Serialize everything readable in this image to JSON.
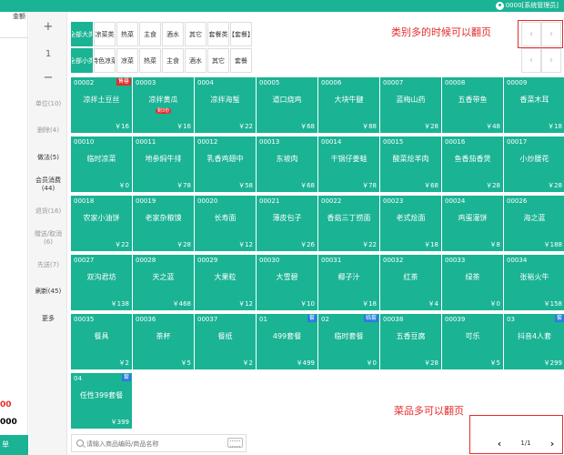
{
  "header": {
    "user_label": "0000[系统管理员]"
  },
  "left_panel": {
    "amount_header": "金额",
    "red_value": "00",
    "black_value": "000",
    "bottom_button": "单"
  },
  "actions": {
    "plus": "+",
    "qty": "1",
    "minus": "−",
    "unit": "单位(10)",
    "delete": "删除(4)",
    "method": "做法(5)",
    "member": "会员消费",
    "member_count": "(44)",
    "return": "退货(16)",
    "gift": "赠送/取消",
    "gift_count": "(6)",
    "deliver": "先送(7)",
    "refresh": "刷新(45)",
    "more": "更多"
  },
  "categories_row1": [
    "全部大类",
    "凉菜类",
    "热菜",
    "主食",
    "酒水",
    "其它",
    "套餐类",
    "【套餐】"
  ],
  "categories_row2": [
    "全部小类",
    "特色凉菜",
    "凉菜",
    "热菜",
    "主食",
    "酒水",
    "其它",
    "套餐"
  ],
  "pager_top": {
    "prev": "‹",
    "next": "›",
    "prev2": "‹",
    "next2": "›"
  },
  "annotations": {
    "top": "类别多的时候可以翻页",
    "bottom": "菜品多可以翻页"
  },
  "tiles": [
    {
      "code": "00002",
      "name": "凉拌土豆丝",
      "price": "￥16",
      "tag": "售罄",
      "tag_color": "red"
    },
    {
      "code": "00003",
      "name": "凉拌黄瓜",
      "price": "￥16",
      "sub": "剩3份"
    },
    {
      "code": "0004",
      "name": "凉拌海蜇",
      "price": "￥22"
    },
    {
      "code": "00005",
      "name": "道口烧鸡",
      "price": "￥68"
    },
    {
      "code": "00006",
      "name": "大块牛腱",
      "price": "￥88"
    },
    {
      "code": "00007",
      "name": "蓝梅山药",
      "price": "￥28"
    },
    {
      "code": "00008",
      "name": "五香带鱼",
      "price": "￥48"
    },
    {
      "code": "00009",
      "name": "香菜木耳",
      "price": "￥18"
    },
    {
      "code": "00010",
      "name": "临时凉菜",
      "price": "￥0"
    },
    {
      "code": "00011",
      "name": "地参焖牛排",
      "price": "￥78"
    },
    {
      "code": "00012",
      "name": "乳香鸡翅中",
      "price": "￥58"
    },
    {
      "code": "00013",
      "name": "东坡肉",
      "price": "￥68"
    },
    {
      "code": "00014",
      "name": "干锅仔姜蛙",
      "price": "￥78"
    },
    {
      "code": "00015",
      "name": "酸菜烩羊肉",
      "price": "￥68"
    },
    {
      "code": "00016",
      "name": "鱼香茄香煲",
      "price": "￥28"
    },
    {
      "code": "00017",
      "name": "小炒腰花",
      "price": "￥28"
    },
    {
      "code": "00018",
      "name": "农家小油饼",
      "price": "￥22"
    },
    {
      "code": "00019",
      "name": "老家杂粮馍",
      "price": "￥28"
    },
    {
      "code": "00020",
      "name": "长寿面",
      "price": "￥12"
    },
    {
      "code": "00021",
      "name": "薄皮包子",
      "price": "￥26"
    },
    {
      "code": "00022",
      "name": "香菇三丁捞面",
      "price": "￥22"
    },
    {
      "code": "00023",
      "name": "老式烩面",
      "price": "￥18"
    },
    {
      "code": "00024",
      "name": "鸡蛋灌饼",
      "price": "￥8"
    },
    {
      "code": "00026",
      "name": "海之蓝",
      "price": "￥188"
    },
    {
      "code": "00027",
      "name": "双沟君坊",
      "price": "￥138"
    },
    {
      "code": "00028",
      "name": "天之蓝",
      "price": "￥468"
    },
    {
      "code": "00029",
      "name": "大果粒",
      "price": "￥12"
    },
    {
      "code": "00030",
      "name": "大雪碧",
      "price": "￥10"
    },
    {
      "code": "00031",
      "name": "椰子汁",
      "price": "￥18"
    },
    {
      "code": "00032",
      "name": "红茶",
      "price": "￥4"
    },
    {
      "code": "00033",
      "name": "绿茶",
      "price": "￥0"
    },
    {
      "code": "00034",
      "name": "张裕火牛",
      "price": "￥158"
    },
    {
      "code": "00035",
      "name": "餐具",
      "price": "￥2"
    },
    {
      "code": "00036",
      "name": "茶杯",
      "price": "￥5"
    },
    {
      "code": "00037",
      "name": "餐纸",
      "price": "￥2"
    },
    {
      "code": "01",
      "name": "499套餐",
      "price": "￥499",
      "tag": "套",
      "tag_color": "blue"
    },
    {
      "code": "02",
      "name": "临时套餐",
      "price": "￥0",
      "tag": "临套",
      "tag_color": "blue"
    },
    {
      "code": "00038",
      "name": "五香豆腐",
      "price": "￥28"
    },
    {
      "code": "00039",
      "name": "可乐",
      "price": "￥5"
    },
    {
      "code": "03",
      "name": "抖音4人套",
      "price": "￥299",
      "tag": "套",
      "tag_color": "blue"
    },
    {
      "code": "04",
      "name": "任性399套餐",
      "price": "￥399",
      "tag": "套",
      "tag_color": "blue"
    }
  ],
  "search": {
    "placeholder": "请输入商品编码/商品名称"
  },
  "pager_bottom": {
    "prev": "‹",
    "page": "1/1",
    "next": "›"
  },
  "colors": {
    "accent": "#1ab394",
    "annotation": "#e52b2b",
    "tag_blue": "#2a7ae2"
  }
}
